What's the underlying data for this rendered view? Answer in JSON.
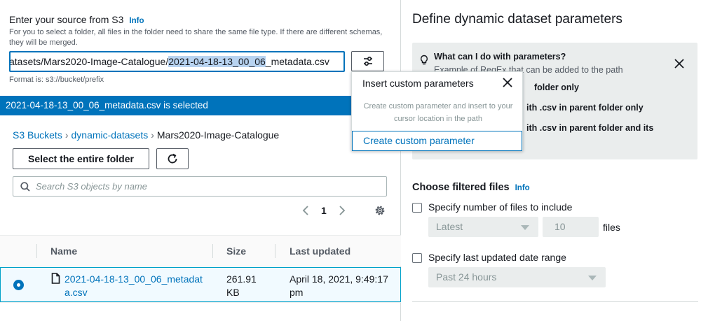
{
  "source": {
    "title": "Enter your source from S3",
    "info": "Info",
    "help": "For you to select a folder, all files in the folder need to share the same file type. If there are different schemas, they will be merged.",
    "path_prefix": "atasets/Mars2020-Image-Catalogue/",
    "path_highlight": "2021-04-18-13_00_06",
    "path_suffix": "_metadata.csv",
    "format_hint": "Format is: s3://bucket/prefix"
  },
  "selection_banner": "2021-04-18-13_00_06_metadata.csv is selected",
  "breadcrumb": {
    "items": [
      "S3 Buckets",
      "dynamic-datasets",
      "Mars2020-Image-Catalogue"
    ]
  },
  "toolbar": {
    "select_folder_label": "Select the entire folder"
  },
  "search": {
    "placeholder": "Search S3 objects by name"
  },
  "pagination": {
    "page": "1"
  },
  "table": {
    "columns": [
      "Name",
      "Size",
      "Last updated"
    ],
    "rows": [
      {
        "name": "2021-04-18-13_00_06_metadata.csv",
        "size": "261.91 KB",
        "last_updated": "April 18, 2021, 9:49:17 pm",
        "selected": true
      }
    ]
  },
  "popover": {
    "title": "Insert custom parameters",
    "description": "Create custom parameter and insert to your cursor location in the path",
    "item": "Create custom parameter"
  },
  "panel": {
    "title": "Define dynamic dataset parameters",
    "help": {
      "question": "What can I do with parameters?",
      "example": "Example of RegEx that can be added to the path",
      "lines": [
        "folder only",
        "ith .csv in parent folder only",
        "ith .csv in parent folder and its"
      ]
    },
    "filter": {
      "title": "Choose filtered files",
      "info": "Info",
      "count_label": "Specify number of files to include",
      "count_select": "Latest",
      "count_value": "10",
      "files_label": "files",
      "date_label": "Specify last updated date range",
      "date_select": "Past 24 hours"
    }
  },
  "colors": {
    "accent": "#0073bb",
    "selection_bar": "#0073bb",
    "row_selected_bg": "#f1faff"
  },
  "icons": [
    "settings-sliders-icon",
    "refresh-icon",
    "search-icon",
    "chevron-left-icon",
    "chevron-right-icon",
    "gear-icon",
    "file-icon",
    "close-icon",
    "lightbulb-icon"
  ]
}
